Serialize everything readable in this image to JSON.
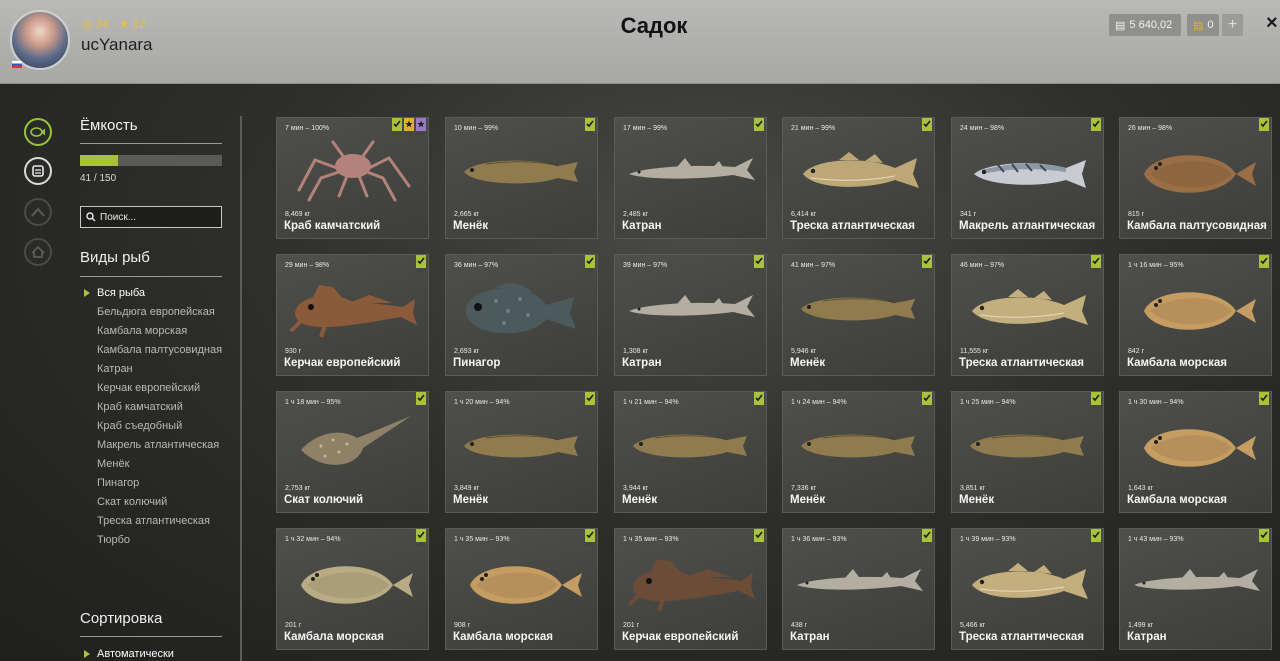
{
  "header": {
    "title": "Садок",
    "username": "ucYanara",
    "stat_level": "34",
    "stat_stars": "12",
    "silver": "5 640,02",
    "gold": "0",
    "add_label": "+",
    "close_label": "×"
  },
  "sidebar": {
    "capacity_heading": "Ёмкость",
    "capacity_count": "41 / 150",
    "capacity_fraction": 0.27,
    "search_placeholder": "Поиск...",
    "species_heading": "Виды рыб",
    "species": [
      "Вся рыба",
      "Бельдюга европейская",
      "Камбала морская",
      "Камбала палтусовидная",
      "Катран",
      "Керчак европейский",
      "Краб камчатский",
      "Краб съедобный",
      "Макрель атлантическая",
      "Менёк",
      "Пинагор",
      "Скат колючий",
      "Треска атлантическая",
      "Тюрбо"
    ],
    "sort_heading": "Сортировка",
    "sort_value": "Автоматически"
  },
  "catches": [
    {
      "time": "7 мин – 100%",
      "weight": "8,469 кг",
      "name": "Краб камчатский",
      "shape": "crab",
      "color": "#b3827a",
      "badges": [
        "green",
        "yellow",
        "purple"
      ]
    },
    {
      "time": "10 мин – 99%",
      "weight": "2,665 кг",
      "name": "Менёк",
      "shape": "eel",
      "color": "#8f7b4d",
      "badges": [
        "green"
      ]
    },
    {
      "time": "17 мин – 99%",
      "weight": "2,485 кг",
      "name": "Катран",
      "shape": "shark",
      "color": "#b4aea2",
      "badges": [
        "green"
      ]
    },
    {
      "time": "21 мин – 99%",
      "weight": "6,414 кг",
      "name": "Треска атлантическая",
      "shape": "cod",
      "color": "#bda777",
      "badges": [
        "green"
      ]
    },
    {
      "time": "24 мин – 98%",
      "weight": "341 г",
      "name": "Макрель атлантическая",
      "shape": "mackerel",
      "color": "#8e98a4",
      "badges": [
        "green"
      ]
    },
    {
      "time": "26 мин – 98%",
      "weight": "815 г",
      "name": "Камбала палтусовидная",
      "shape": "flatfish",
      "color": "#9a6f46",
      "badges": [
        "green"
      ]
    },
    {
      "time": "29 мин – 98%",
      "weight": "930 г",
      "name": "Керчак европейский",
      "shape": "sculpin",
      "color": "#8a5a3a",
      "badges": [
        "green"
      ]
    },
    {
      "time": "36 мин – 97%",
      "weight": "2,693 кг",
      "name": "Пинагор",
      "shape": "lumpsucker",
      "color": "#4c5a5c",
      "badges": [
        "green"
      ]
    },
    {
      "time": "39 мин – 97%",
      "weight": "1,308 кг",
      "name": "Катран",
      "shape": "shark",
      "color": "#b4aea2",
      "badges": [
        "green"
      ]
    },
    {
      "time": "41 мин – 97%",
      "weight": "5,946 кг",
      "name": "Менёк",
      "shape": "eel",
      "color": "#8f7b4d",
      "badges": [
        "green"
      ]
    },
    {
      "time": "46 мин – 97%",
      "weight": "11,555 кг",
      "name": "Треска атлантическая",
      "shape": "cod",
      "color": "#c3ae7e",
      "badges": [
        "green"
      ]
    },
    {
      "time": "1 ч 16 мин – 95%",
      "weight": "842 г",
      "name": "Камбала морская",
      "shape": "flatfish",
      "color": "#c59d63",
      "badges": [
        "green"
      ]
    },
    {
      "time": "1 ч 18 мин – 95%",
      "weight": "2,753 кг",
      "name": "Скат колючий",
      "shape": "ray",
      "color": "#8f8168",
      "badges": [
        "green"
      ]
    },
    {
      "time": "1 ч 20 мин – 94%",
      "weight": "3,849 кг",
      "name": "Менёк",
      "shape": "eel",
      "color": "#8f7b4d",
      "badges": [
        "green"
      ]
    },
    {
      "time": "1 ч 21 мин – 94%",
      "weight": "3,944 кг",
      "name": "Менёк",
      "shape": "eel",
      "color": "#8f7b4d",
      "badges": [
        "green"
      ]
    },
    {
      "time": "1 ч 24 мин – 94%",
      "weight": "7,336 кг",
      "name": "Менёк",
      "shape": "eel",
      "color": "#8f7b4d",
      "badges": [
        "green"
      ]
    },
    {
      "time": "1 ч 25 мин – 94%",
      "weight": "3,851 кг",
      "name": "Менёк",
      "shape": "eel",
      "color": "#8f7b4d",
      "badges": [
        "green"
      ]
    },
    {
      "time": "1 ч 30 мин – 94%",
      "weight": "1,643 кг",
      "name": "Камбала морская",
      "shape": "flatfish",
      "color": "#c59d63",
      "badges": [
        "green"
      ]
    },
    {
      "time": "1 ч 32 мин – 94%",
      "weight": "201 г",
      "name": "Камбала морская",
      "shape": "flatfish",
      "color": "#b9ac84",
      "badges": [
        "green"
      ]
    },
    {
      "time": "1 ч 35 мин – 93%",
      "weight": "908 г",
      "name": "Камбала морская",
      "shape": "flatfish",
      "color": "#c59d63",
      "badges": [
        "green"
      ]
    },
    {
      "time": "1 ч 35 мин – 93%",
      "weight": "201 г",
      "name": "Керчак европейский",
      "shape": "sculpin",
      "color": "#6b4c36",
      "badges": [
        "green"
      ]
    },
    {
      "time": "1 ч 36 мин – 93%",
      "weight": "438 г",
      "name": "Катран",
      "shape": "shark",
      "color": "#b4aea2",
      "badges": [
        "green"
      ]
    },
    {
      "time": "1 ч 39 мин – 93%",
      "weight": "5,466 кг",
      "name": "Треска атлантическая",
      "shape": "cod",
      "color": "#c3ae7e",
      "badges": [
        "green"
      ]
    },
    {
      "time": "1 ч 43 мин – 93%",
      "weight": "1,499 кг",
      "name": "Катран",
      "shape": "shark",
      "color": "#b4aea2",
      "badges": [
        "green"
      ]
    }
  ]
}
